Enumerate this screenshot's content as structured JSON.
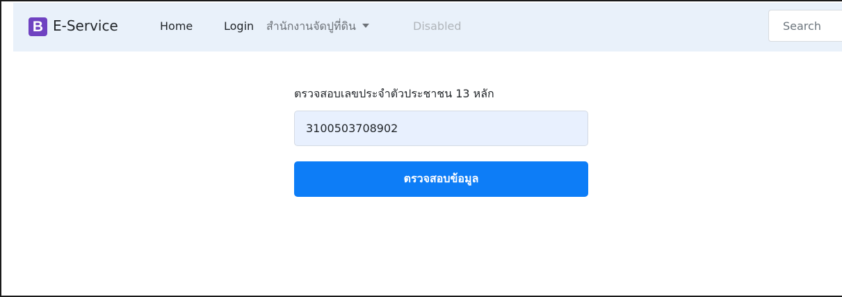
{
  "navbar": {
    "brand_logo": "B",
    "brand_name": "E-Service",
    "links": {
      "home": "Home",
      "login": "Login",
      "dropdown": "สำนักงานจัดปูที่ดิน",
      "disabled": "Disabled"
    },
    "search_placeholder": "Search"
  },
  "form": {
    "label": "ตรวจสอบเลขประจำตัวประชาชน 13 หลัก",
    "id_value": "3100503708902",
    "submit_label": "ตรวจสอบข้อมูล"
  },
  "colors": {
    "navbar_bg": "#e9f1fa",
    "brand_logo": "#6f42c1",
    "primary_button": "#0d7df7",
    "input_autofill_bg": "#e8f0fe"
  }
}
